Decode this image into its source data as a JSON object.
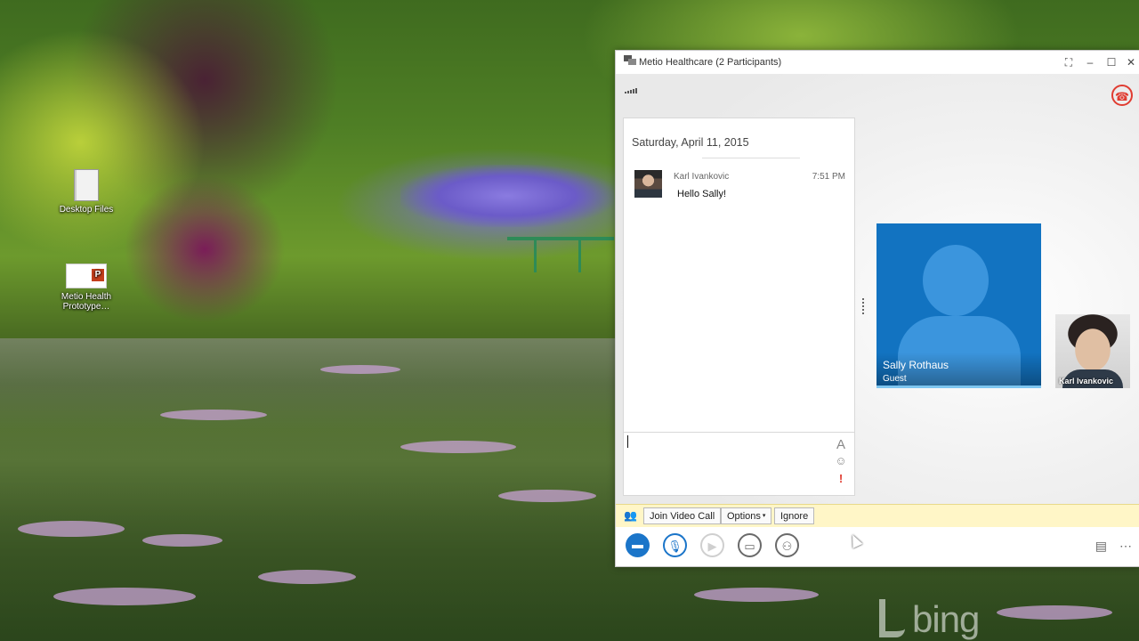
{
  "desktop": {
    "icons": [
      {
        "label": "Desktop Files",
        "icon": "folder-icon"
      },
      {
        "label": "Metio Health Prototype…",
        "icon": "powerpoint-file-icon"
      }
    ],
    "watermark": "bing"
  },
  "window": {
    "title": "Metio Healthcare (2 Participants)",
    "controls": [
      "compact-view-icon",
      "minimize-icon",
      "maximize-icon",
      "close-icon"
    ]
  },
  "conversation": {
    "date": "Saturday, April 11, 2015",
    "messages": [
      {
        "sender": "Karl Ivankovic",
        "time": "7:51 PM",
        "text": "Hello Sally!"
      }
    ],
    "compose_value": ""
  },
  "participants": [
    {
      "name": "Sally Rothaus",
      "role": "Guest",
      "color": "#1273c1"
    },
    {
      "name": "Karl Ivankovic"
    }
  ],
  "notification": {
    "icon": "group-video-icon",
    "buttons": {
      "join": "Join Video Call",
      "options": "Options",
      "ignore": "Ignore"
    }
  },
  "toolbar": {
    "buttons": [
      "im-icon",
      "microphone-icon",
      "video-icon",
      "present-icon",
      "participants-icon"
    ],
    "right": [
      "conversation-layout-icon",
      "more-options-icon"
    ]
  },
  "colors": {
    "accent": "#1b75c9",
    "hangup": "#e03c31",
    "notify_bg": "#fff6c7"
  }
}
